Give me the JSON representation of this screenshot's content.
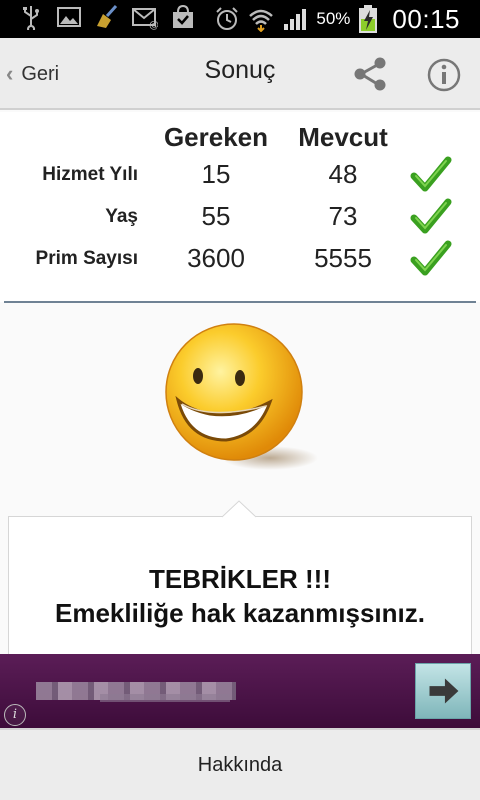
{
  "status_bar": {
    "battery_percent": "50%",
    "time": "00:15",
    "icons": [
      "usb-icon",
      "image-icon",
      "broom-icon",
      "email-icon",
      "shopping-bag-icon",
      "alarm-icon",
      "wifi-icon",
      "signal-icon",
      "battery-charging-icon"
    ]
  },
  "action_bar": {
    "back_label": "Geri",
    "title": "Sonuç"
  },
  "results": {
    "headers": {
      "required": "Gereken",
      "current": "Mevcut"
    },
    "rows": [
      {
        "label": "Hizmet Yılı",
        "required": "15",
        "current": "48",
        "ok": true
      },
      {
        "label": "Yaş",
        "required": "55",
        "current": "73",
        "ok": true
      },
      {
        "label": "Prim Sayısı",
        "required": "3600",
        "current": "5555",
        "ok": true
      }
    ]
  },
  "message": {
    "line1": "TEBRİKLER !!!",
    "line2": "Emekliliğe hak kazanmışsınız."
  },
  "bottom_bar": {
    "label": "Hakkında"
  },
  "colors": {
    "divider": "#6f8294",
    "check_green": "#3aa020",
    "smiley_yellow": "#f5b51c",
    "ad_purple": "#4a1446"
  }
}
